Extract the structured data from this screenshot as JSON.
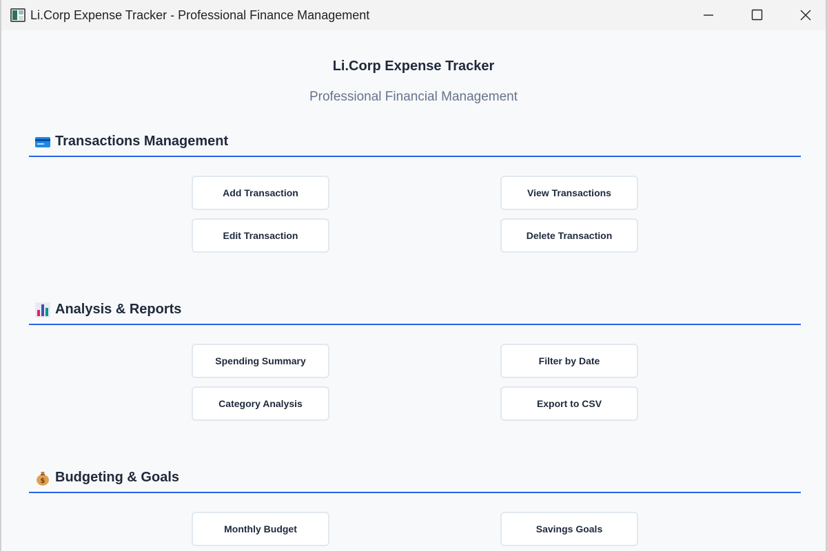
{
  "window": {
    "title": "Li.Corp Expense Tracker - Professional Finance Management"
  },
  "header": {
    "title": "Li.Corp Expense Tracker",
    "subtitle": "Professional Financial Management"
  },
  "sections": [
    {
      "icon": "credit-card-icon",
      "title": "Transactions Management",
      "buttons": [
        "Add Transaction",
        "View Transactions",
        "Edit Transaction",
        "Delete Transaction"
      ]
    },
    {
      "icon": "bar-chart-icon",
      "title": "Analysis & Reports",
      "buttons": [
        "Spending Summary",
        "Filter by Date",
        "Category Analysis",
        "Export to CSV"
      ]
    },
    {
      "icon": "money-bag-icon",
      "title": "Budgeting & Goals",
      "buttons": [
        "Monthly Budget",
        "Savings Goals"
      ]
    }
  ],
  "colors": {
    "accent": "#2563eb",
    "background": "#f8f9fa",
    "text": "#1e293b",
    "subtitle": "#64748b",
    "button_border": "#e2e8f0"
  }
}
